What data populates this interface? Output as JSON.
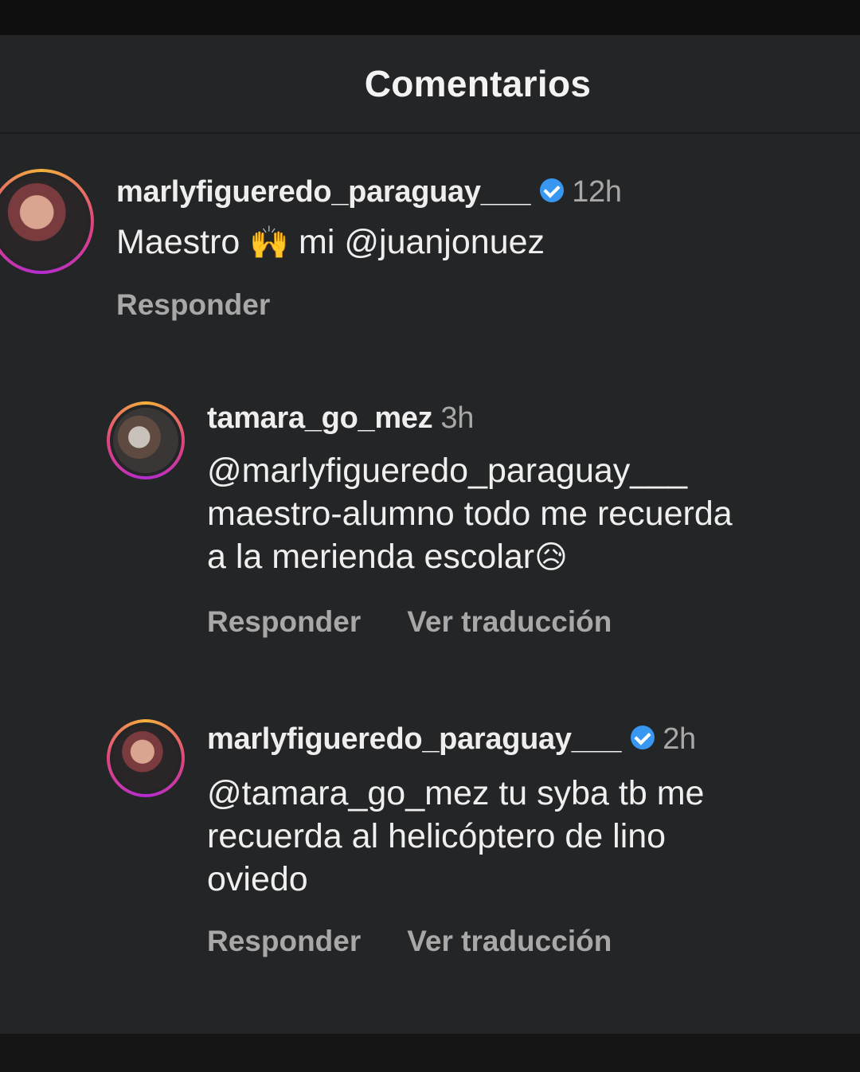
{
  "header": {
    "title": "Comentarios"
  },
  "comments": [
    {
      "username": "marlyfigueredo_paraguay___",
      "time": "12h",
      "verified": true,
      "text_before": "Maestro ",
      "emoji": "🙌",
      "text_after": " mi @juanjonuez",
      "reply_label": "Responder"
    },
    {
      "username": "tamara_go_mez",
      "time": "3h",
      "verified": false,
      "lines": [
        "@marlyfigueredo_paraguay___",
        "maestro-alumno todo me recuerda",
        "a la merienda escolar"
      ],
      "emoji": "😥",
      "reply_label": "Responder",
      "translate_label": "Ver traducción"
    },
    {
      "username": "marlyfigueredo_paraguay___",
      "time": "2h",
      "verified": true,
      "lines": [
        "@tamara_go_mez tu syba tb me",
        "recuerda al helicóptero de lino",
        "oviedo"
      ],
      "reply_label": "Responder",
      "translate_label": "Ver traducción"
    }
  ]
}
